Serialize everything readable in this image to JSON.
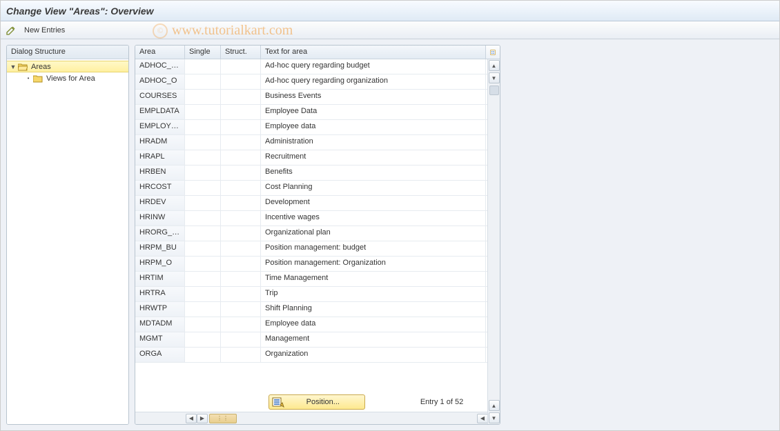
{
  "titlebar": {
    "title": "Change View \"Areas\": Overview"
  },
  "toolbar": {
    "new_entries_label": "New Entries"
  },
  "watermark": {
    "copy_glyph": "©",
    "text": "www.tutorialkart.com"
  },
  "tree": {
    "header": "Dialog Structure",
    "root": {
      "arrow": "▼",
      "label": "Areas",
      "selected": true
    },
    "child": {
      "bullet": "•",
      "label": "Views for Area"
    }
  },
  "table": {
    "headers": {
      "area": "Area",
      "single": "Single",
      "struct": "Struct.",
      "text": "Text for area"
    },
    "rows": [
      {
        "area": "ADHOC_BU",
        "single": "",
        "struct": "",
        "text": "Ad-hoc query regarding budget"
      },
      {
        "area": "ADHOC_O",
        "single": "",
        "struct": "",
        "text": "Ad-hoc query regarding organization"
      },
      {
        "area": "COURSES",
        "single": "",
        "struct": "",
        "text": "Business Events"
      },
      {
        "area": "EMPLDATA",
        "single": "",
        "struct": "",
        "text": "Employee Data"
      },
      {
        "area": "EMPLOYEE",
        "single": "",
        "struct": "",
        "text": "Employee data"
      },
      {
        "area": "HRADM",
        "single": "",
        "struct": "",
        "text": "Administration"
      },
      {
        "area": "HRAPL",
        "single": "",
        "struct": "",
        "text": "Recruitment"
      },
      {
        "area": "HRBEN",
        "single": "",
        "struct": "",
        "text": "Benefits"
      },
      {
        "area": "HRCOST",
        "single": "",
        "struct": "",
        "text": "Cost Planning"
      },
      {
        "area": "HRDEV",
        "single": "",
        "struct": "",
        "text": "Development"
      },
      {
        "area": "HRINW",
        "single": "",
        "struct": "",
        "text": "Incentive wages"
      },
      {
        "area": "HRORG_ST",
        "single": "",
        "struct": "",
        "text": "Organizational plan"
      },
      {
        "area": "HRPM_BU",
        "single": "",
        "struct": "",
        "text": "Position management: budget"
      },
      {
        "area": "HRPM_O",
        "single": "",
        "struct": "",
        "text": "Position management: Organization"
      },
      {
        "area": "HRTIM",
        "single": "",
        "struct": "",
        "text": "Time Management"
      },
      {
        "area": "HRTRA",
        "single": "",
        "struct": "",
        "text": "Trip"
      },
      {
        "area": "HRWTP",
        "single": "",
        "struct": "",
        "text": "Shift Planning"
      },
      {
        "area": "MDTADM",
        "single": "",
        "struct": "",
        "text": "Employee data"
      },
      {
        "area": "MGMT",
        "single": "",
        "struct": "",
        "text": "Management"
      },
      {
        "area": "ORGA",
        "single": "",
        "struct": "",
        "text": "Organization"
      }
    ]
  },
  "footer": {
    "position_label": "Position...",
    "entry_info": "Entry 1 of 52"
  },
  "glyphs": {
    "up": "▲",
    "down": "▼",
    "left": "◀",
    "right": "▶",
    "grip": "⋮⋮"
  }
}
